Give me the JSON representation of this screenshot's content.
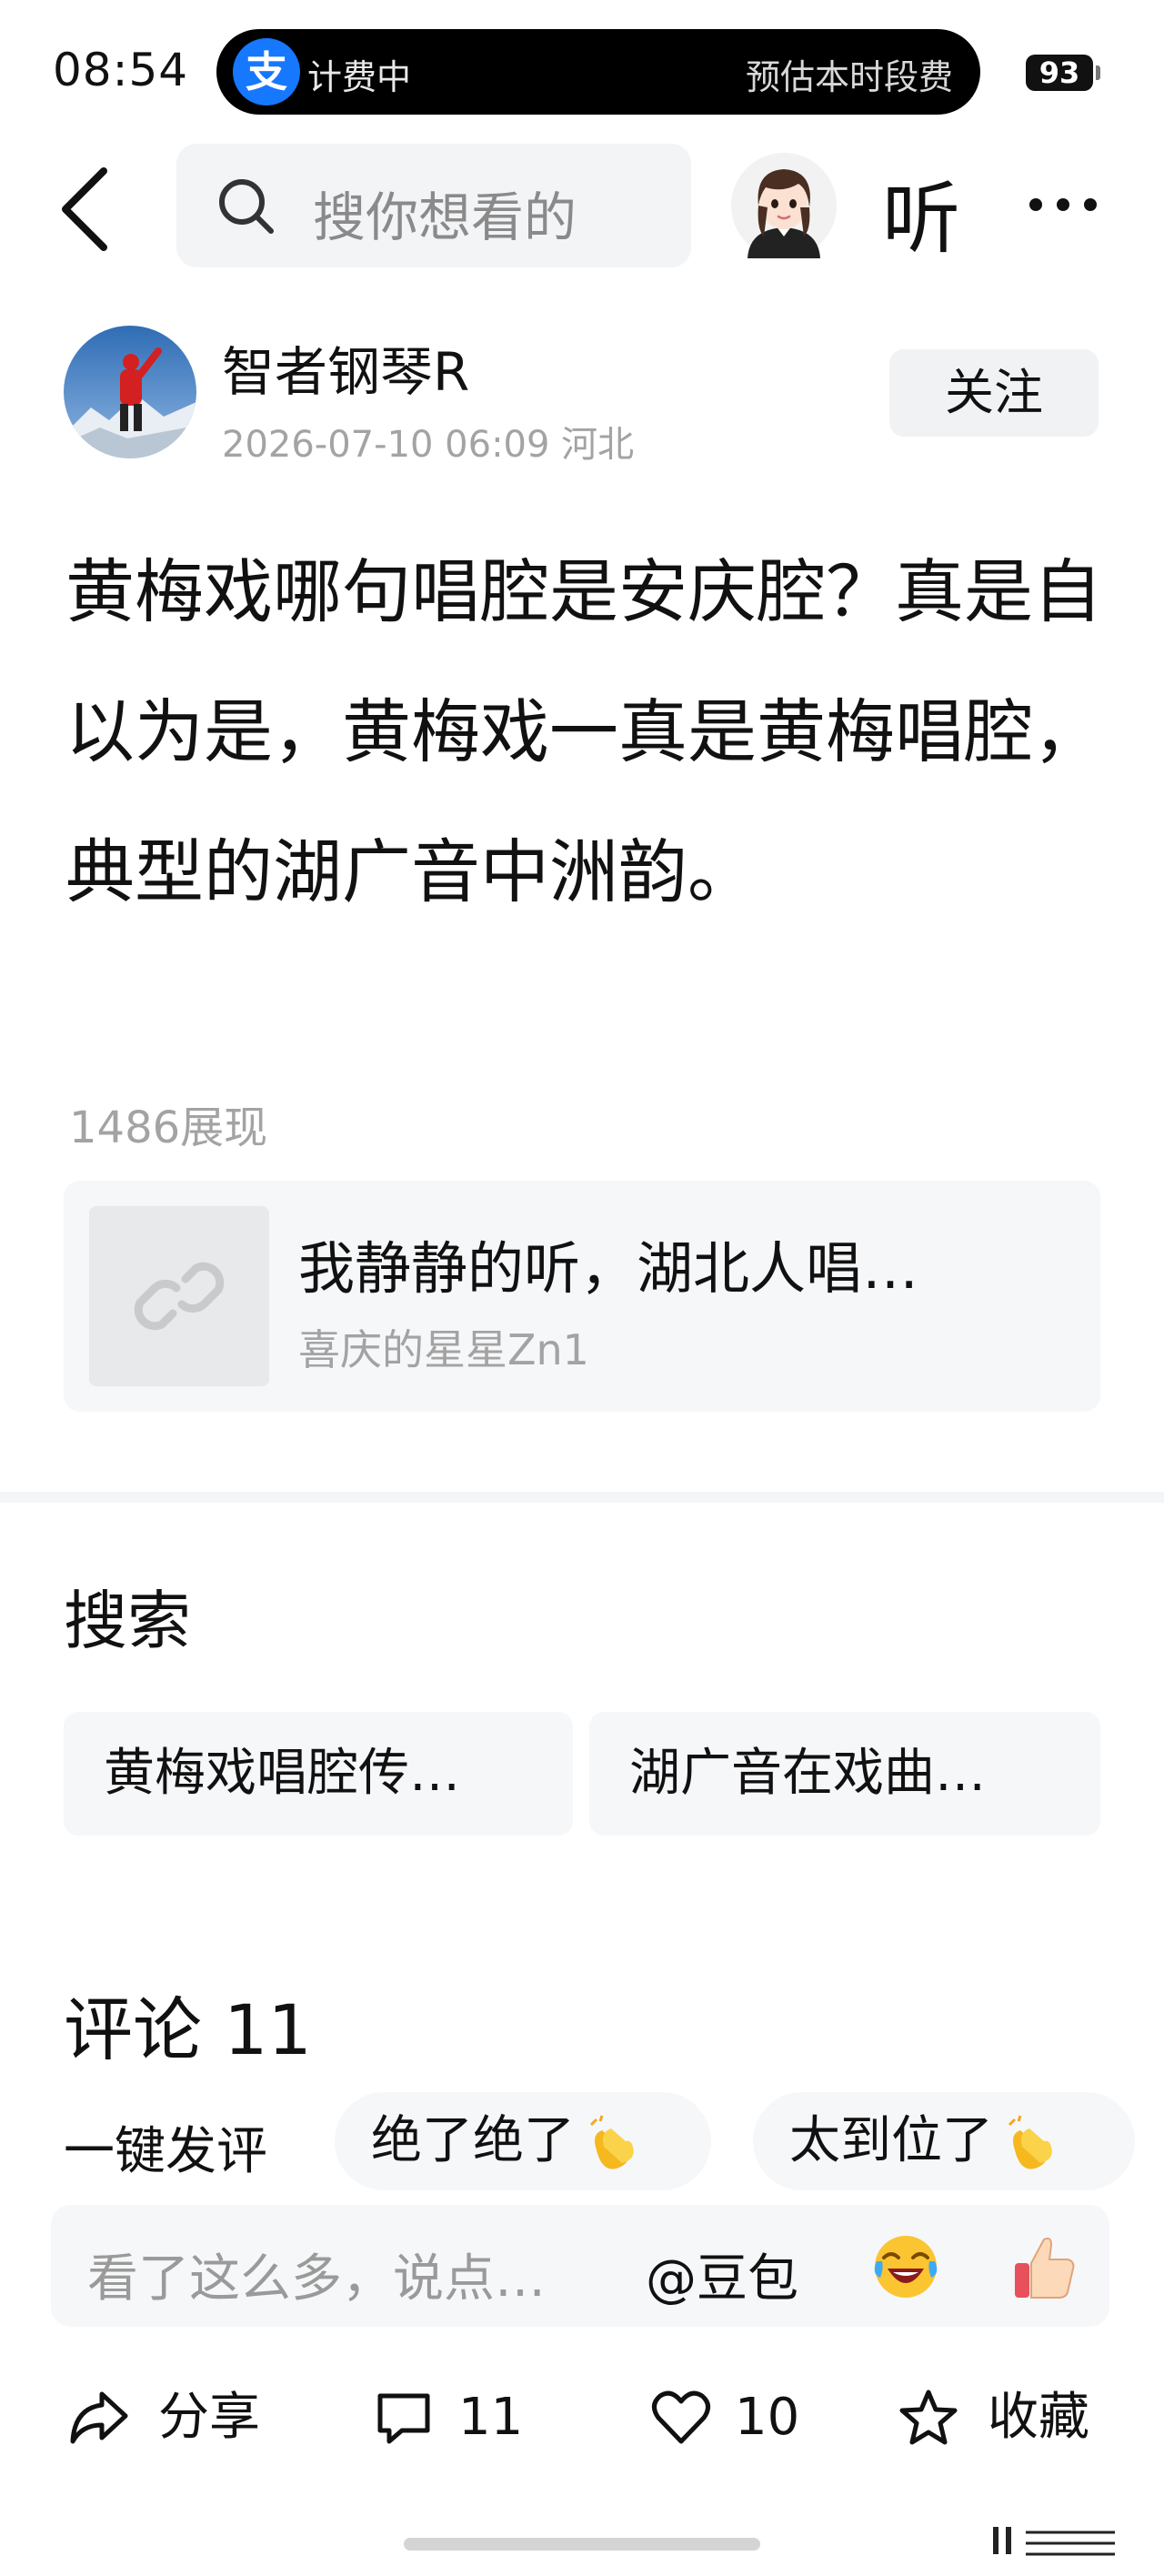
{
  "status_bar": {
    "time": "08:54",
    "live_activity": {
      "app_icon_char": "支",
      "left_text": "计费中",
      "right_text": "预估本时段费"
    },
    "battery": "93"
  },
  "nav": {
    "search_placeholder": "搜你想看的",
    "listen_label": "听"
  },
  "author": {
    "name": "智者钢琴R",
    "meta": "2026-07-10 06:09 河北",
    "follow_label": "关注"
  },
  "post": {
    "text": "黄梅戏哪句唱腔是安庆腔？真是自以为是，黄梅戏一真是黄梅唱腔，典型的湖广音中洲韵。",
    "views": "1486展现"
  },
  "link_card": {
    "title": "我静静的听，湖北人唱…",
    "author": "喜庆的星星Zn1"
  },
  "search_section": {
    "title": "搜索",
    "suggestions": [
      "黄梅戏唱腔传…",
      "湖广音在戏曲…"
    ]
  },
  "comments": {
    "title": "评论 11",
    "quick_label": "一键发评",
    "quick_chips": [
      "绝了绝了",
      "太到位了"
    ],
    "input_placeholder": "看了这么多，说点…",
    "mention": "@豆包"
  },
  "actions": {
    "share": "分享",
    "comment_count": "11",
    "like_count": "10",
    "favorite": "收藏"
  },
  "colors": {
    "accent_blue": "#1677ff",
    "secondary_text": "#a3a3a3",
    "card_bg": "#f6f7f9"
  }
}
